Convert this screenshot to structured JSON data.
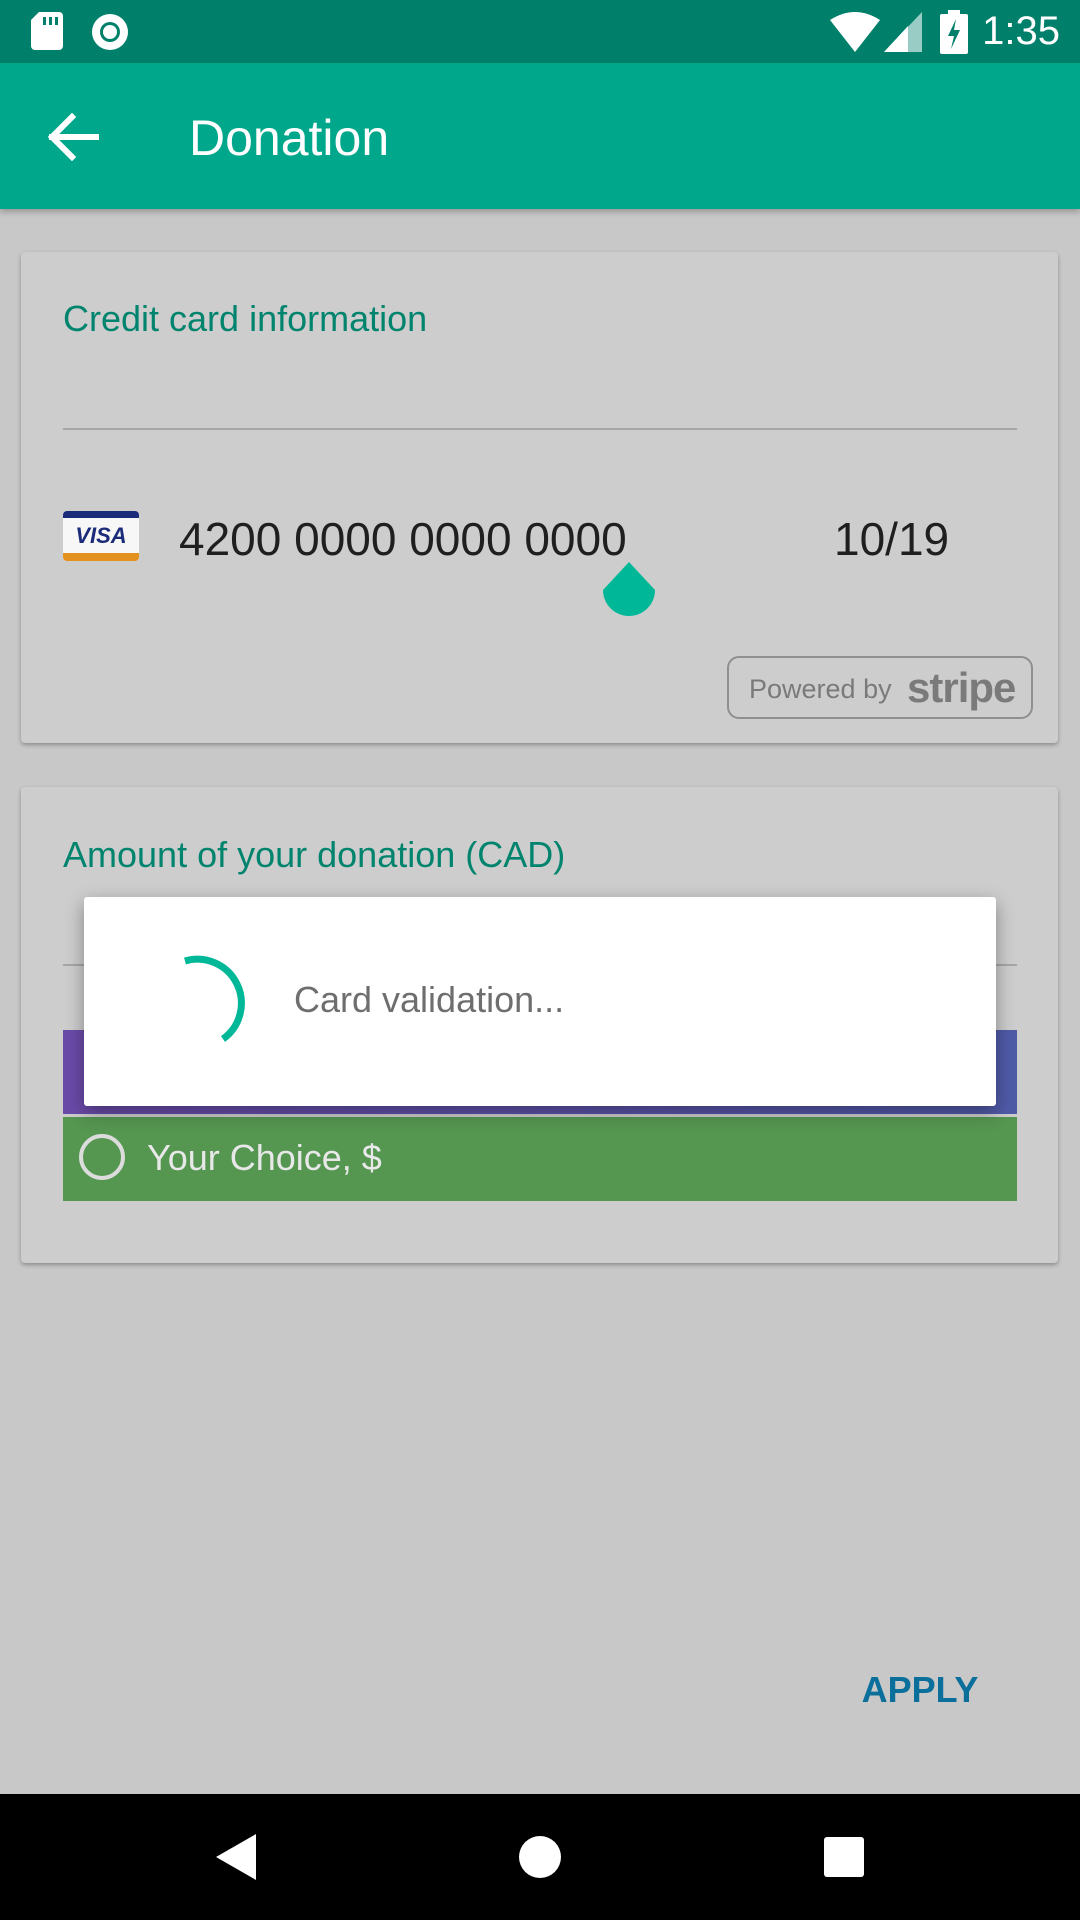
{
  "status_bar": {
    "time": "1:35",
    "icons": [
      "sd-card-icon",
      "record-icon",
      "wifi-icon",
      "cell-signal-icon",
      "battery-charging-icon"
    ]
  },
  "app_bar": {
    "title": "Donation",
    "back_icon": "arrow-left-icon",
    "background": "#00a78a"
  },
  "credit_card": {
    "heading": "Credit card information",
    "brand": "VISA",
    "number": "4200 0000 0000 0000",
    "expiry": "10/19",
    "powered_by": "Powered by",
    "processor": "stripe"
  },
  "donation": {
    "heading": "Amount of your donation (CAD)",
    "choice_label": "Your Choice, $"
  },
  "apply_label": "APPLY",
  "dialog": {
    "message": "Card validation..."
  },
  "nav_bar": {
    "buttons": [
      "back-triangle-icon",
      "home-circle-icon",
      "recents-square-icon"
    ]
  },
  "colors": {
    "accent": "#00a78a",
    "status_bar": "#00806b",
    "heading_text": "#00846e",
    "apply": "#0a6f9a",
    "choice_row": "#559651"
  }
}
